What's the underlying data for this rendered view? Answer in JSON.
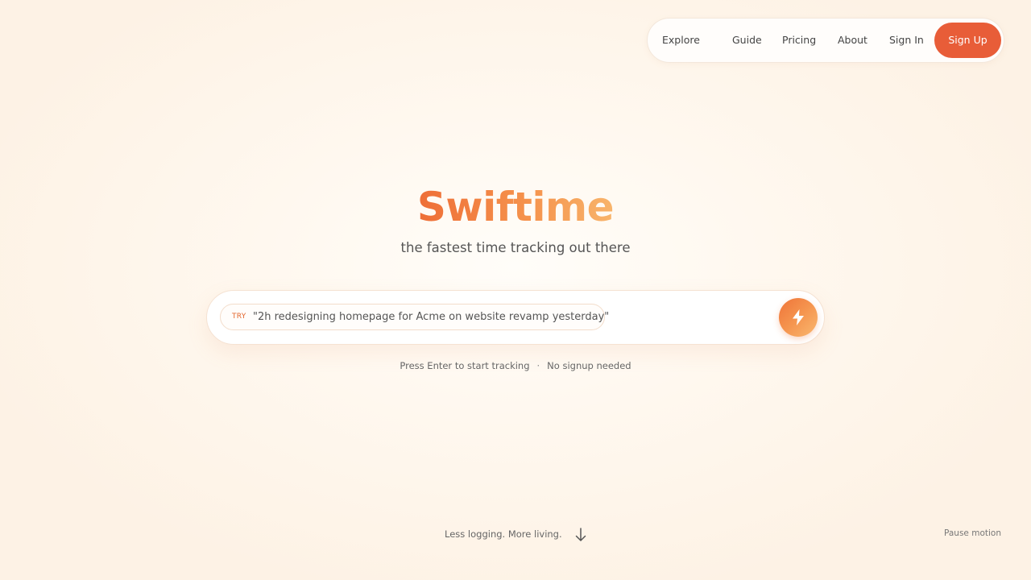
{
  "nav": {
    "explore": "Explore",
    "guide": "Guide",
    "pricing": "Pricing",
    "about": "About",
    "sign_in": "Sign In",
    "sign_up": "Sign Up"
  },
  "hero": {
    "title": "Swiftime",
    "tagline": "the fastest time tracking out there"
  },
  "search": {
    "try_badge": "TRY",
    "example": "\"2h redesigning homepage for Acme on website revamp yesterday\"",
    "submit_icon": "lightning-bolt-icon"
  },
  "hints": {
    "enter": "Press Enter to start tracking",
    "separator": "·",
    "no_signup": "No signup needed"
  },
  "footer": {
    "slogan": "Less logging. More living.",
    "scroll_icon": "arrow-down-icon",
    "pause_motion": "Pause motion"
  },
  "colors": {
    "accent": "#e85d38",
    "gradient_start": "#ee6e37",
    "gradient_end": "#f8b46b"
  }
}
